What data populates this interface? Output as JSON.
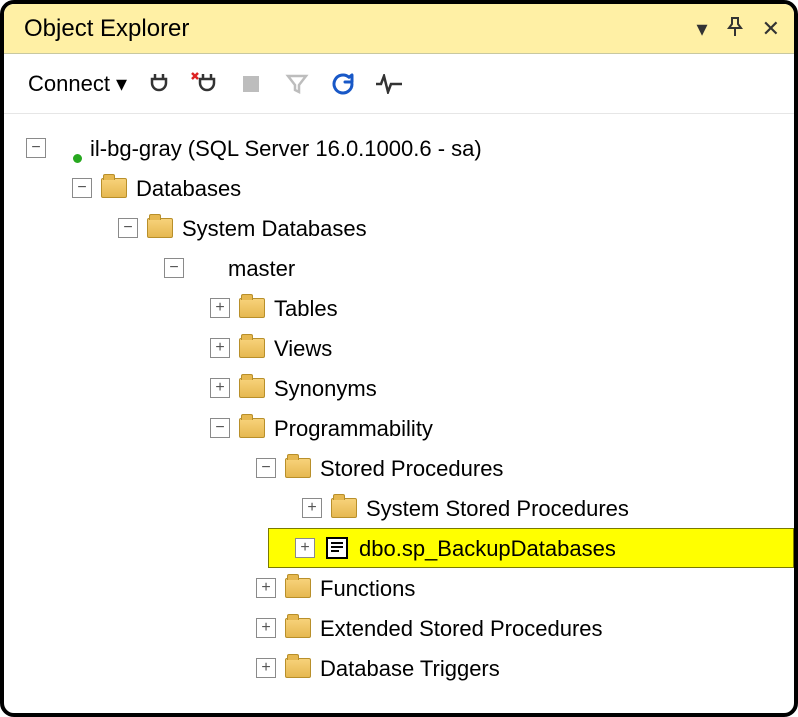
{
  "panel": {
    "title": "Object Explorer"
  },
  "toolbar": {
    "connect_label": "Connect",
    "icons": {
      "plug": "plug-icon",
      "plug_x": "disconnect-icon",
      "stop": "stop-icon",
      "filter": "filter-icon",
      "refresh": "refresh-icon",
      "activity": "activity-monitor-icon"
    }
  },
  "tree": {
    "server": {
      "label": "il-bg-gray (SQL Server 16.0.1000.6 - sa)",
      "databases": {
        "label": "Databases",
        "system_databases": {
          "label": "System Databases",
          "master": {
            "label": "master",
            "tables": "Tables",
            "views": "Views",
            "synonyms": "Synonyms",
            "programmability": {
              "label": "Programmability",
              "stored_procedures": {
                "label": "Stored Procedures",
                "system_sp": "System Stored Procedures",
                "backup_sp": "dbo.sp_BackupDatabases"
              },
              "functions": "Functions",
              "ext_sp": "Extended Stored Procedures",
              "db_triggers": "Database Triggers"
            }
          }
        }
      }
    }
  }
}
